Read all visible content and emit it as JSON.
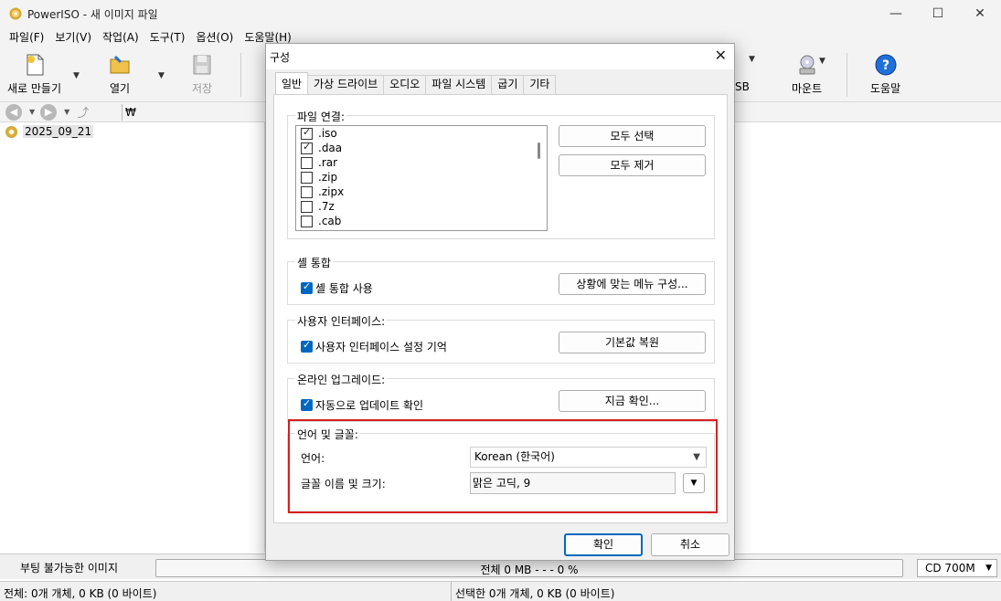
{
  "window": {
    "title": "PowerISO - 새 이미지 파일",
    "minimize": "—",
    "maximize": "☐",
    "close": "✕"
  },
  "menu": [
    "파일(F)",
    "보기(V)",
    "작업(A)",
    "도구(T)",
    "옵션(O)",
    "도움말(H)"
  ],
  "toolbar": {
    "new_label": "새로 만들기",
    "open_label": "열기",
    "save_label": "저장",
    "usb_label": "SB",
    "mount_label": "마운트",
    "help_label": "도움말"
  },
  "address": {
    "value": "₩"
  },
  "tree": {
    "item": "2025_09_21"
  },
  "dialog": {
    "title": "구성",
    "tabs": [
      "일반",
      "가상 드라이브",
      "오디오",
      "파일 시스템",
      "굽기",
      "기타"
    ],
    "file_assoc": {
      "title": "파일 연결:",
      "items": [
        {
          "label": ".iso",
          "checked": true
        },
        {
          "label": ".daa",
          "checked": true
        },
        {
          "label": ".rar",
          "checked": false
        },
        {
          "label": ".zip",
          "checked": false
        },
        {
          "label": ".zipx",
          "checked": false
        },
        {
          "label": ".7z",
          "checked": false
        },
        {
          "label": ".cab",
          "checked": false
        }
      ],
      "select_all": "모두 선택",
      "remove_all": "모두 제거"
    },
    "shell": {
      "title": "셸 통합",
      "checkbox": "셸 통합 사용",
      "button": "상황에 맞는 메뉴 구성..."
    },
    "ui": {
      "title": "사용자 인터페이스:",
      "checkbox": "사용자 인터페이스 설정 기억",
      "button": "기본값 복원"
    },
    "update": {
      "title": "온라인 업그레이드:",
      "checkbox": "자동으로 업데이트 확인",
      "button": "지금 확인..."
    },
    "lang": {
      "title": "언어 및 글꼴:",
      "language_label": "언어:",
      "language_value": "Korean (한국어)",
      "font_label": "글꼴 이름 및 크기:",
      "font_value": "맑은 고딕, 9"
    },
    "ok": "확인",
    "cancel": "취소"
  },
  "status": {
    "label": "부팅 불가능한 이미지",
    "progress_text": "전체 0 MB   - - -  0 %",
    "progress_fraction": 0,
    "media": "CD 700M",
    "total": "전체: 0개  개체, 0 KB (0 바이트)",
    "selected": "선택한 0개 개체, 0 KB (0 바이트)"
  },
  "colors": {
    "accent": "#0067c0",
    "highlight": "#d61f1f",
    "progress": "#06b025"
  }
}
